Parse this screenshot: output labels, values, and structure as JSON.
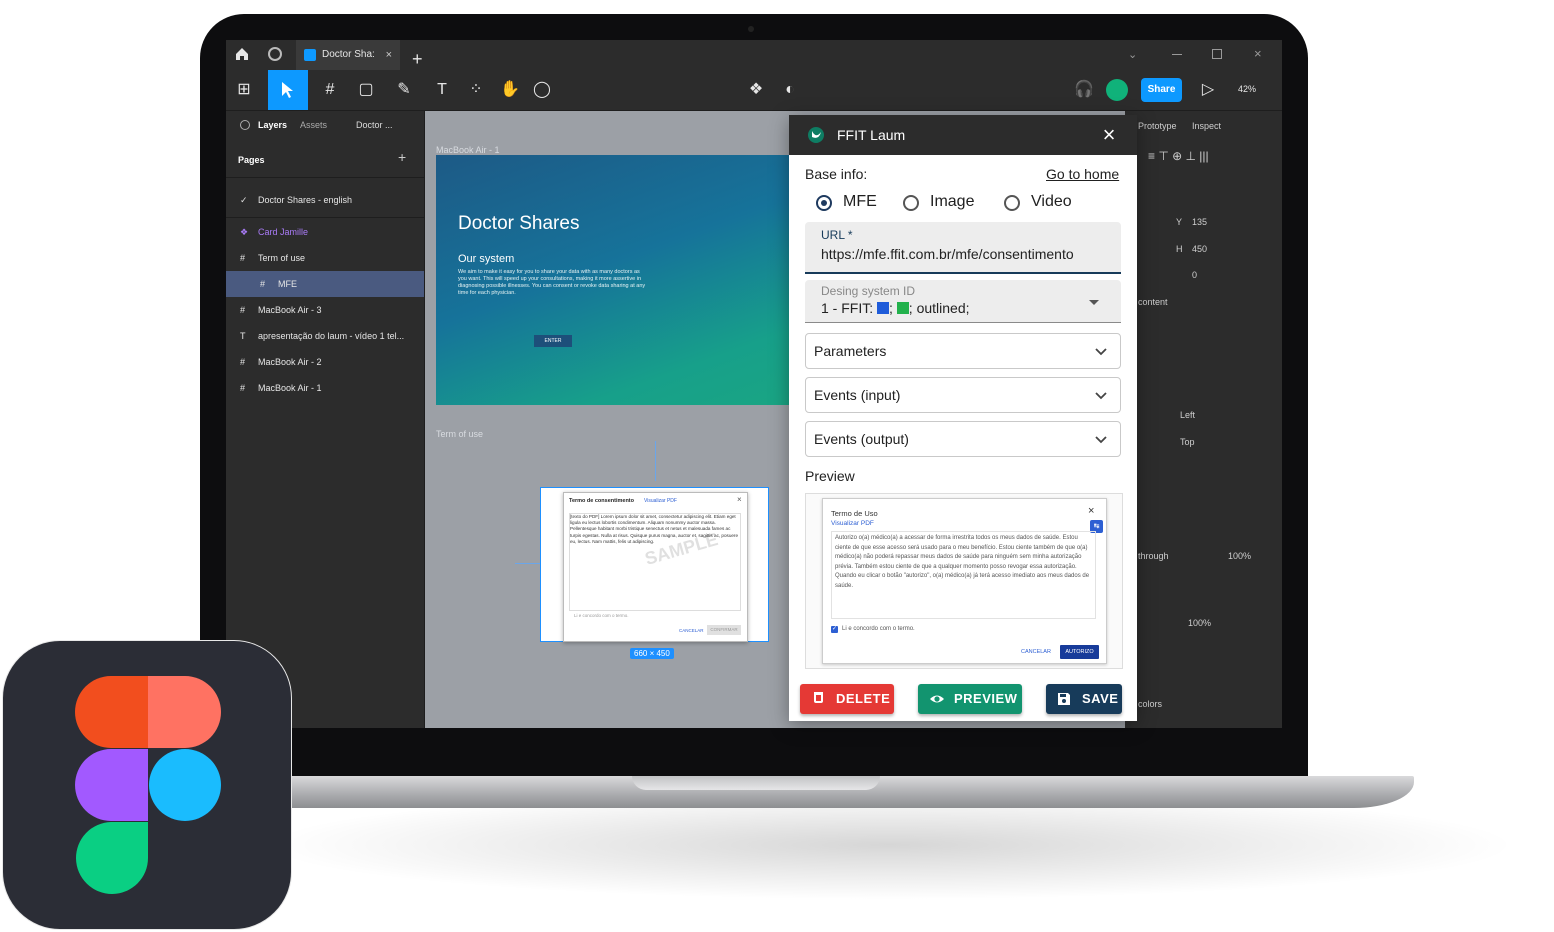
{
  "figma": {
    "tab_label": "Doctor Sha:",
    "tab_close": "×",
    "share_label": "Share",
    "zoom": "42%",
    "left_tabs": [
      "Layers",
      "Assets",
      "Doctor ..."
    ],
    "pages_label": "Pages",
    "layers": [
      {
        "label": "Doctor Shares - english",
        "icon": "check-icon"
      },
      {
        "label": "Card Jamille",
        "icon": "component-icon"
      },
      {
        "label": "Term of use",
        "icon": "frame-icon"
      },
      {
        "label": "MFE",
        "icon": "frame-icon"
      },
      {
        "label": "MacBook Air - 3",
        "icon": "frame-icon"
      },
      {
        "label": "apresentação do laum - vídeo 1 tel...",
        "icon": "text-icon"
      },
      {
        "label": "MacBook Air - 2",
        "icon": "frame-icon"
      },
      {
        "label": "MacBook Air - 1",
        "icon": "frame-icon"
      }
    ],
    "right_tabs": [
      "Prototype",
      "Inspect"
    ],
    "props": {
      "y": "135",
      "h": "450",
      "r": "0",
      "content": "content",
      "left": "Left",
      "top": "Top",
      "through": "through",
      "opacity1": "100%",
      "opacity2": "100%",
      "colors": "colors"
    },
    "canvas": {
      "frame1_name": "MacBook Air - 1",
      "hero_title": "Doctor Shares",
      "hero_subtitle": "Our system",
      "hero_body": "We aim to make it easy for you to share your data with as many doctors as you want. This will speed up your consultations, making it more assertive in diagnosing possible illnesses. You can consent or revoke data sharing at any time for each physician.",
      "hero_button": "ENTER",
      "frame2_name": "Term of use",
      "dialog_title": "Termo de consentimento",
      "dialog_link": "Visualizar PDF",
      "dialog_text": "[texto do PDF] Lorem ipsum dolor sit amet, consectetur adipiscing elit. Etiam eget ligula eu lectus lobortis condimentum. Aliquam nonummy auctor massa. Pellentesque habitant morbi tristique senectus et netus et malesuada fames ac turpis egestas. Nulla at risus. Quisque purus magna, auctor et, sagittis ac, posuere eu, lectus. Nam mattis, felis ut adipiscing.",
      "dialog_watermark": "SAMPLE",
      "dialog_check": "Li e concordo com o termo.",
      "dialog_cancel": "CANCELAR",
      "dialog_confirm": "CONFIRMAR",
      "size_badge": "660 × 450"
    }
  },
  "plugin": {
    "title": "FFIT Laum",
    "base_info": "Base info:",
    "go_home": "Go to home",
    "radios": [
      {
        "label": "MFE",
        "checked": true
      },
      {
        "label": "Image",
        "checked": false
      },
      {
        "label": "Video",
        "checked": false
      }
    ],
    "url": {
      "label": "URL *",
      "value": "https://mfe.ffit.com.br/mfe/consentimento"
    },
    "design_system": {
      "label": "Desing system ID",
      "value_prefix": "1 - FFIT:",
      "value_suffix": "; outlined;",
      "swatch1": "#1e5bd9",
      "swatch2": "#22b14c"
    },
    "accordions": [
      "Parameters",
      "Events (input)",
      "Events (output)"
    ],
    "preview_label": "Preview",
    "preview": {
      "title": "Termo de Uso",
      "link": "Visualizar PDF",
      "text": "Autorizo o(a) médico(a) a acessar de forma irrestrita todos os meus dados de saúde. Estou ciente de que esse acesso será usado para o meu benefício. Estou ciente também de que o(a) médico(a) não poderá repassar meus dados de saúde para ninguém sem minha autorização prévia. Também estou ciente de que a qualquer momento posso revogar essa autorização. Quando eu clicar o botão \"autorizo\", o(a) médico(a) já terá acesso imediato aos meus dados de saúde.",
      "check": "Li e concordo com o termo.",
      "cancel": "CANCELAR",
      "confirm": "AUTORIZO"
    },
    "buttons": {
      "delete": "DELETE",
      "preview": "PREVIEW",
      "save": "SAVE"
    },
    "colors": {
      "delete": "#e53935",
      "preview": "#12946f",
      "save": "#173b5a"
    }
  }
}
